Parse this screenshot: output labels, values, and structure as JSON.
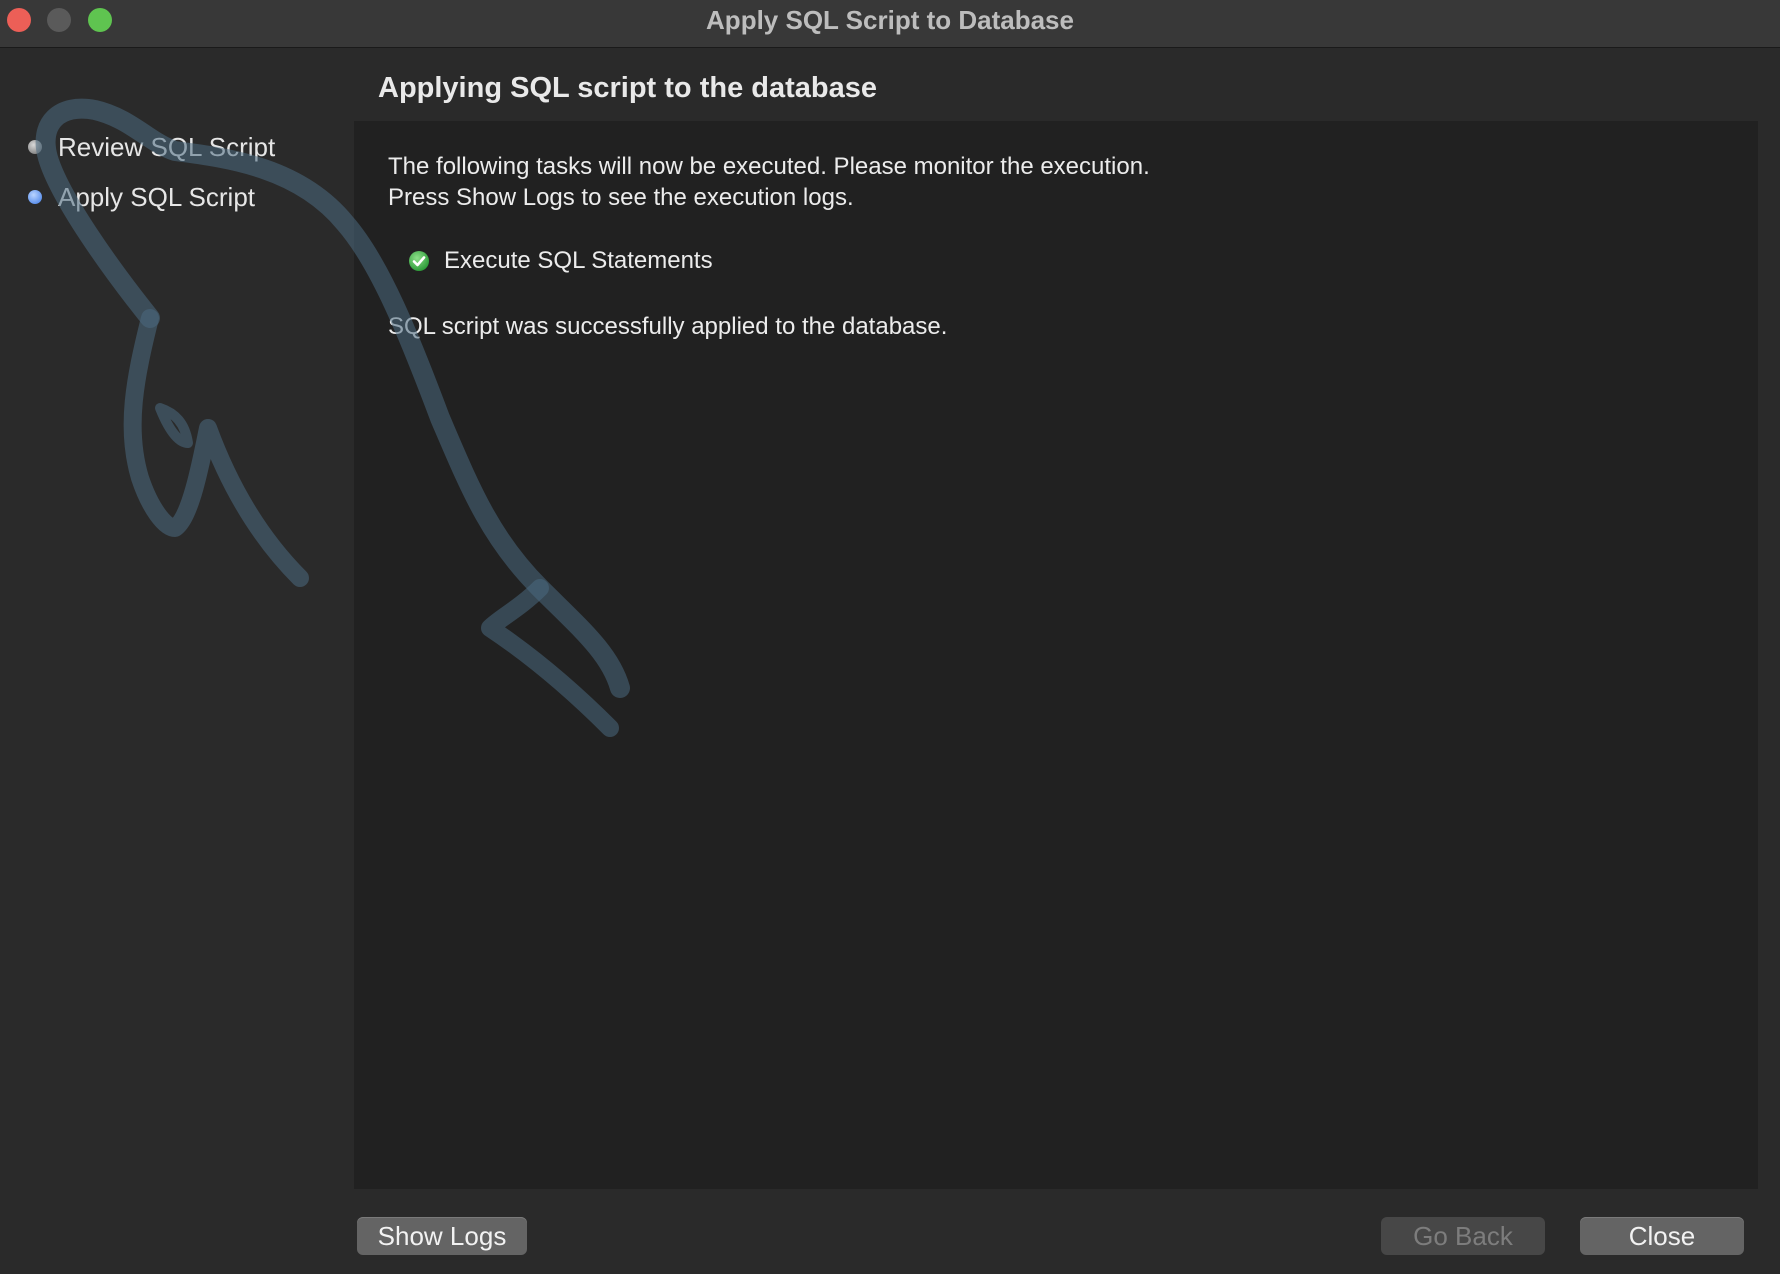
{
  "window": {
    "title": "Apply SQL Script to Database",
    "controls": {
      "close": "close-window-button",
      "minimize": "minimize-window-button",
      "zoom": "zoom-window-button"
    }
  },
  "sidebar": {
    "steps": [
      {
        "label": "Review SQL Script",
        "state": "done"
      },
      {
        "label": "Apply SQL Script",
        "state": "current"
      }
    ]
  },
  "main": {
    "heading": "Applying SQL script to the database",
    "intro_line1": "The following tasks will now be executed. Please monitor the execution.",
    "intro_line2": "Press Show Logs to see the execution logs.",
    "tasks": [
      {
        "label": "Execute SQL Statements",
        "status": "success",
        "icon": "check-circle-icon"
      }
    ],
    "result": "SQL script was successfully applied to the database."
  },
  "footer": {
    "show_logs_label": "Show Logs",
    "go_back_label": "Go Back",
    "go_back_enabled": false,
    "close_label": "Close"
  },
  "colors": {
    "traffic_close": "#ec5f57",
    "traffic_zoom": "#5fc450",
    "step_current": "#3d7ae6",
    "success_green": "#3fb950"
  }
}
